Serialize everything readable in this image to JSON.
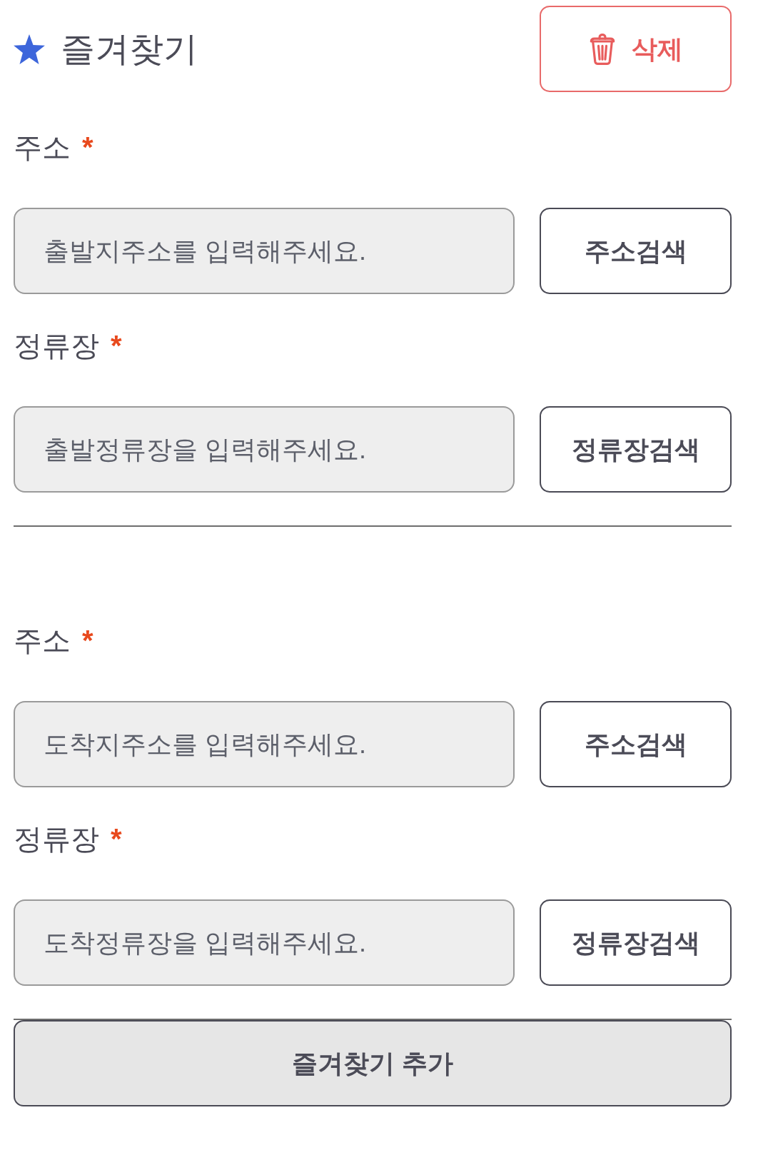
{
  "header": {
    "title": "즐겨찾기",
    "delete_button": "삭제"
  },
  "sections": [
    {
      "fields": [
        {
          "label": "주소",
          "required_mark": "*",
          "placeholder": "출발지주소를 입력해주세요.",
          "button": "주소검색"
        },
        {
          "label": "정류장",
          "required_mark": "*",
          "placeholder": "출발정류장을 입력해주세요.",
          "button": "정류장검색"
        }
      ]
    },
    {
      "fields": [
        {
          "label": "주소",
          "required_mark": "*",
          "placeholder": "도착지주소를 입력해주세요.",
          "button": "주소검색"
        },
        {
          "label": "정류장",
          "required_mark": "*",
          "placeholder": "도착정류장을 입력해주세요.",
          "button": "정류장검색"
        }
      ]
    }
  ],
  "add_button": "즐겨찾기 추가"
}
